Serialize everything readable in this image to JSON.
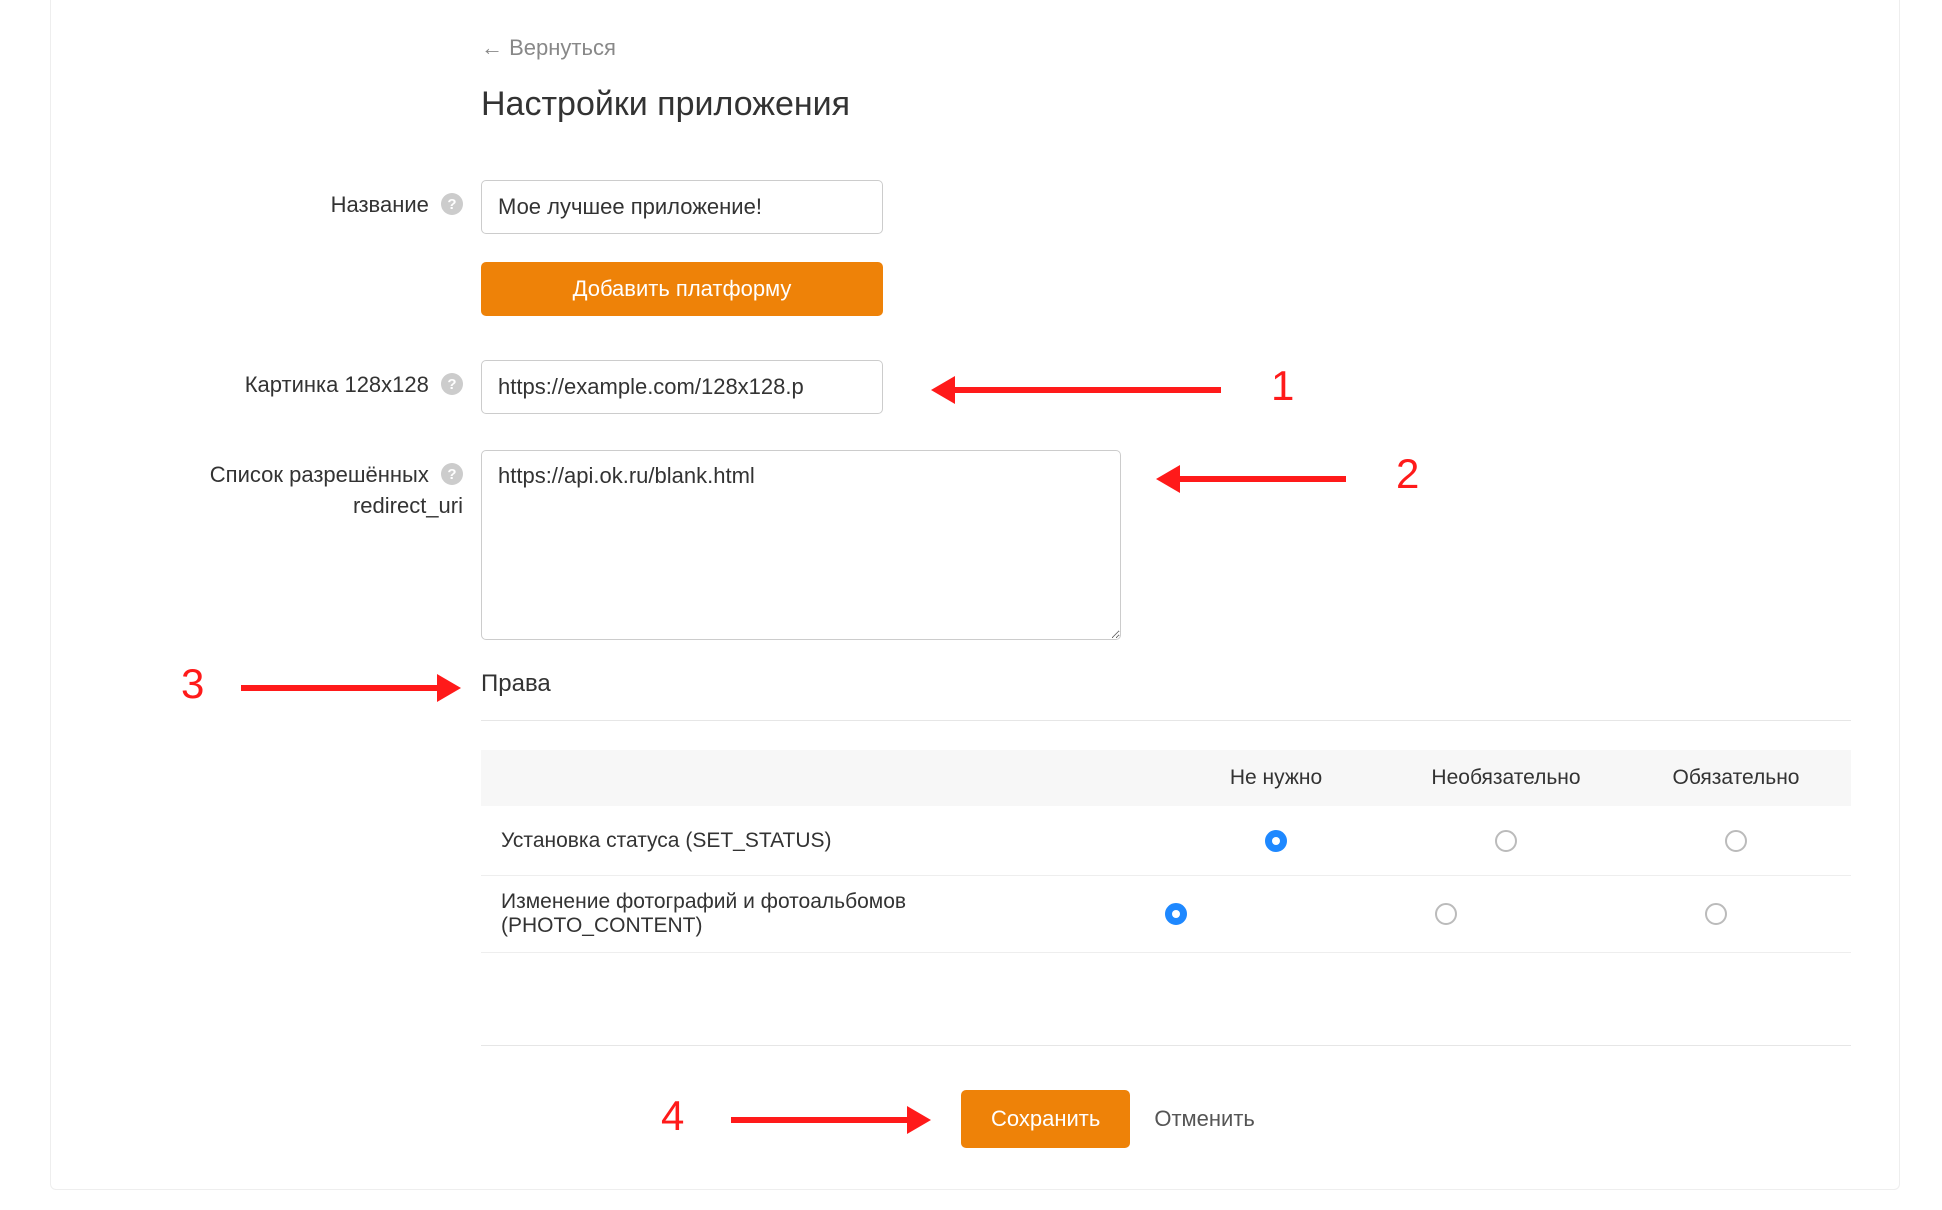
{
  "header": {
    "back_label": "← Вернуться",
    "title": "Настройки приложения"
  },
  "form": {
    "name_label": "Название",
    "name_value": "Мое лучшее приложение!",
    "add_platform_label": "Добавить платформу",
    "image_label": "Картинка 128x128",
    "image_value": "https://example.com/128x128.p",
    "redirect_label_line1": "Список разрешённых",
    "redirect_label_line2": "redirect_uri",
    "redirect_value": "https://api.ok.ru/blank.html",
    "rights_heading": "Права"
  },
  "perm_columns": {
    "c1": "Не нужно",
    "c2": "Необязательно",
    "c3": "Обязательно"
  },
  "permissions": [
    {
      "label": "Установка статуса (SET_STATUS)",
      "selected": "c1"
    },
    {
      "label": "Изменение фотографий и фотоальбомов (PHOTO_CONTENT)",
      "selected": "c1"
    }
  ],
  "footer": {
    "save_label": "Сохранить",
    "cancel_label": "Отменить"
  },
  "annotations": {
    "n1": "1",
    "n2": "2",
    "n3": "3",
    "n4": "4"
  }
}
